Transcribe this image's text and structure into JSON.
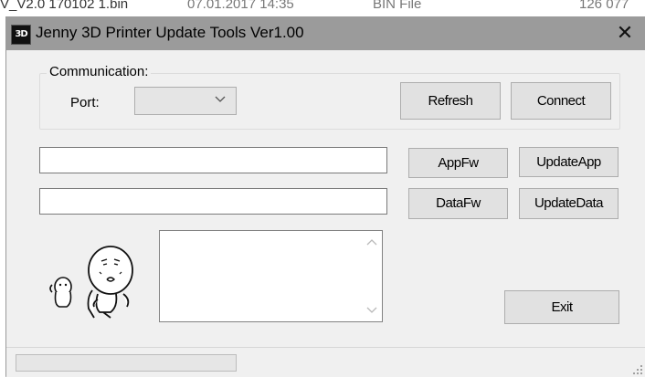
{
  "background_file": {
    "name": "V_V2.0 170102 1.bin",
    "date": "07.01.2017 14:35",
    "type": "BIN File",
    "size": "126 077"
  },
  "window": {
    "icon_text": "3D",
    "title": "Jenny 3D Printer Update Tools Ver1.00"
  },
  "communication": {
    "group_label": "Communication:",
    "port_label": "Port:",
    "port_value": "",
    "refresh_label": "Refresh",
    "connect_label": "Connect"
  },
  "firmware": {
    "app_path": "",
    "data_path": "",
    "appfw_label": "AppFw",
    "updateapp_label": "UpdateApp",
    "datafw_label": "DataFw",
    "updatedata_label": "UpdateData"
  },
  "log": {
    "text": ""
  },
  "exit_label": "Exit",
  "status": {
    "progress": 0
  },
  "icons": [
    "app-icon",
    "close-icon",
    "chevron-down-icon",
    "scroll-up-icon",
    "scroll-down-icon",
    "mascot-icon",
    "size-grip-icon"
  ]
}
